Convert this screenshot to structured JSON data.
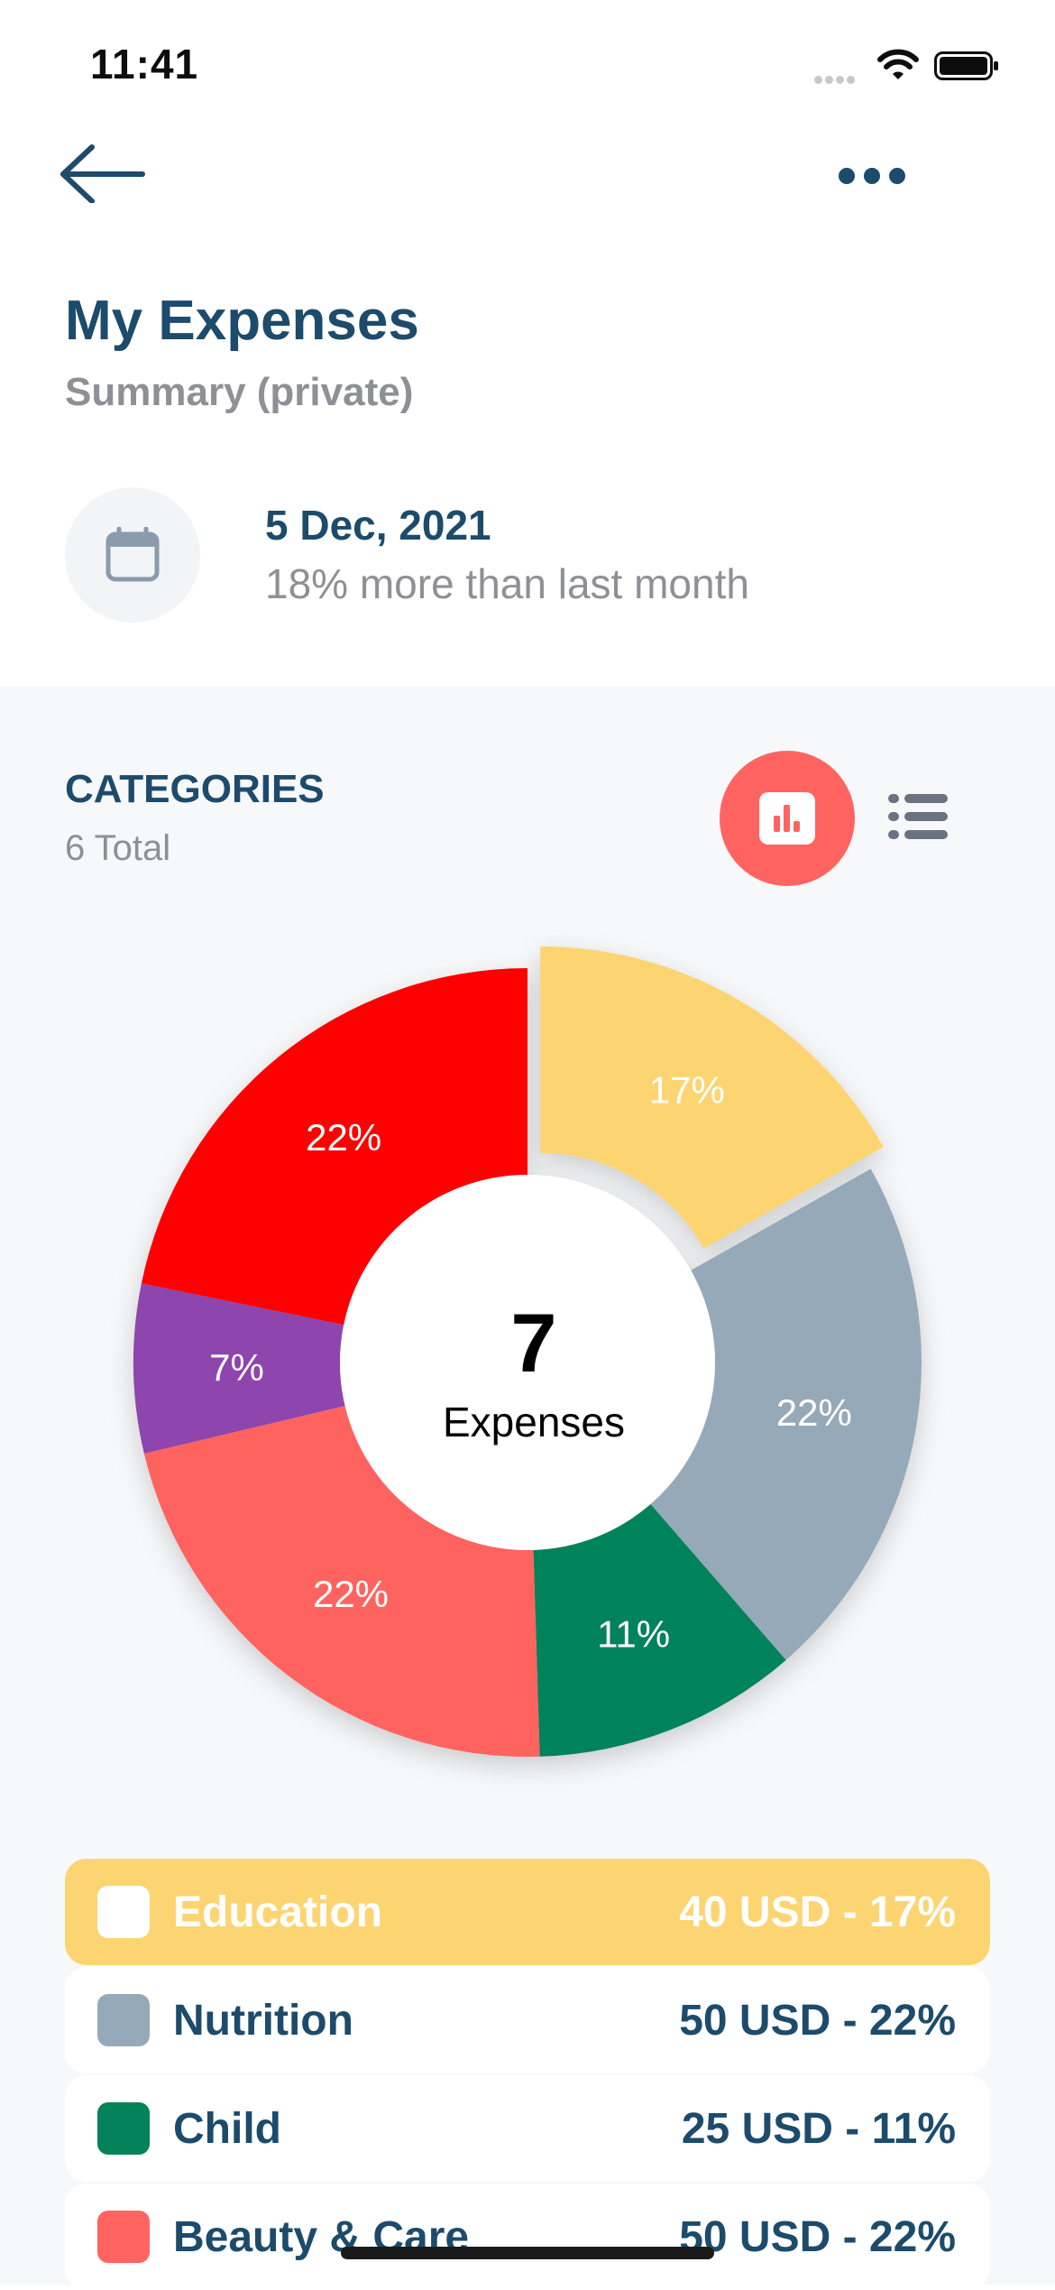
{
  "status_bar": {
    "time": "11:41"
  },
  "header": {
    "title": "My Expenses",
    "subtitle": "Summary (private)",
    "back_icon": "arrow-left-icon",
    "more_icon": "more-horizontal-icon"
  },
  "date_info": {
    "icon": "calendar-icon",
    "date": "5 Dec, 2021",
    "comparison": "18% more than last month"
  },
  "categories": {
    "title": "CATEGORIES",
    "total": "6 Total",
    "view_chart_icon": "bar-chart-icon",
    "view_list_icon": "list-icon"
  },
  "chart_data": {
    "type": "pie",
    "center_value": "7",
    "center_label": "Expenses",
    "slices": [
      {
        "label": "17%",
        "value": 17,
        "color": "#fcd572",
        "highlighted": true
      },
      {
        "label": "22%",
        "value": 22,
        "color": "#96a9b8"
      },
      {
        "label": "11%",
        "value": 11,
        "color": "#04825a"
      },
      {
        "label": "22%",
        "value": 22,
        "color": "#ff6460"
      },
      {
        "label": "7%",
        "value": 7,
        "color": "#8e44ad"
      },
      {
        "label": "22%",
        "value": 22,
        "color": "#ff0000"
      }
    ]
  },
  "legend": [
    {
      "name": "Education",
      "amount": "40 USD - 17%",
      "color": "#ffffff",
      "active": true
    },
    {
      "name": "Nutrition",
      "amount": "50 USD - 22%",
      "color": "#96a9b8"
    },
    {
      "name": "Child",
      "amount": "25 USD - 11%",
      "color": "#04825a"
    },
    {
      "name": "Beauty & Care",
      "amount": "50 USD - 22%",
      "color": "#ff6460"
    }
  ],
  "colors": {
    "primary": "#1c4b6c",
    "accent": "#ff6460",
    "muted": "#8f8f96"
  }
}
